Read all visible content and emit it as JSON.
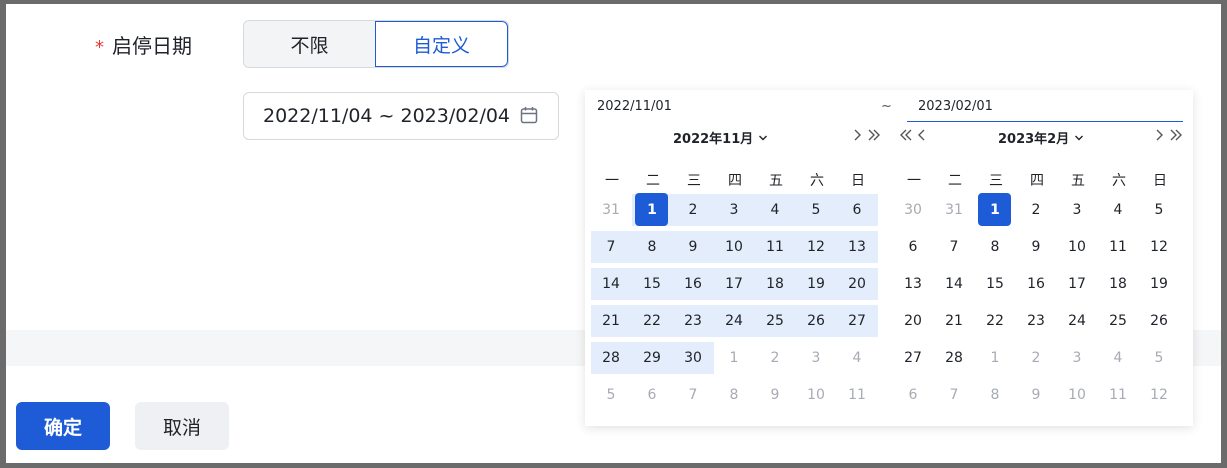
{
  "form": {
    "date_label": "启停日期",
    "required_mark": "*",
    "options": [
      "不限",
      "自定义"
    ],
    "selected_option": "自定义",
    "range_value": "2022/11/04 ~ 2023/02/04"
  },
  "picker": {
    "start_input": "2022/11/01",
    "separator": "~",
    "end_input": "2023/02/01",
    "weekdays": [
      "一",
      "二",
      "三",
      "四",
      "五",
      "六",
      "日"
    ],
    "left_month": {
      "title": "2022年11月",
      "days": [
        [
          "31",
          "1",
          "2",
          "3",
          "4",
          "5",
          "6"
        ],
        [
          "7",
          "8",
          "9",
          "10",
          "11",
          "12",
          "13"
        ],
        [
          "14",
          "15",
          "16",
          "17",
          "18",
          "19",
          "20"
        ],
        [
          "21",
          "22",
          "23",
          "24",
          "25",
          "26",
          "27"
        ],
        [
          "28",
          "29",
          "30",
          "1",
          "2",
          "3",
          "4"
        ],
        [
          "5",
          "6",
          "7",
          "8",
          "9",
          "10",
          "11"
        ]
      ],
      "first_in_month": [
        0,
        1
      ],
      "last_in_month": [
        4,
        2
      ],
      "selected": [
        0,
        1
      ]
    },
    "right_month": {
      "title": "2023年2月",
      "days": [
        [
          "30",
          "31",
          "1",
          "2",
          "3",
          "4",
          "5"
        ],
        [
          "6",
          "7",
          "8",
          "9",
          "10",
          "11",
          "12"
        ],
        [
          "13",
          "14",
          "15",
          "16",
          "17",
          "18",
          "19"
        ],
        [
          "20",
          "21",
          "22",
          "23",
          "24",
          "25",
          "26"
        ],
        [
          "27",
          "28",
          "1",
          "2",
          "3",
          "4",
          "5"
        ],
        [
          "6",
          "7",
          "8",
          "9",
          "10",
          "11",
          "12"
        ]
      ],
      "first_in_month": [
        0,
        2
      ],
      "last_in_month": [
        4,
        1
      ],
      "selected": [
        0,
        2
      ]
    }
  },
  "footer": {
    "ok_label": "确定",
    "cancel_label": "取消"
  },
  "colors": {
    "primary": "#1e5bd6",
    "range_fill": "#e3edfb",
    "required": "#e53935"
  },
  "icons": {
    "range_input": "calendar-icon",
    "prev": "chevron-left-icon",
    "next": "chevron-right-icon",
    "prev_year": "double-chevron-left-icon",
    "next_year": "double-chevron-right-icon",
    "month_dropdown": "chevron-down-icon"
  }
}
